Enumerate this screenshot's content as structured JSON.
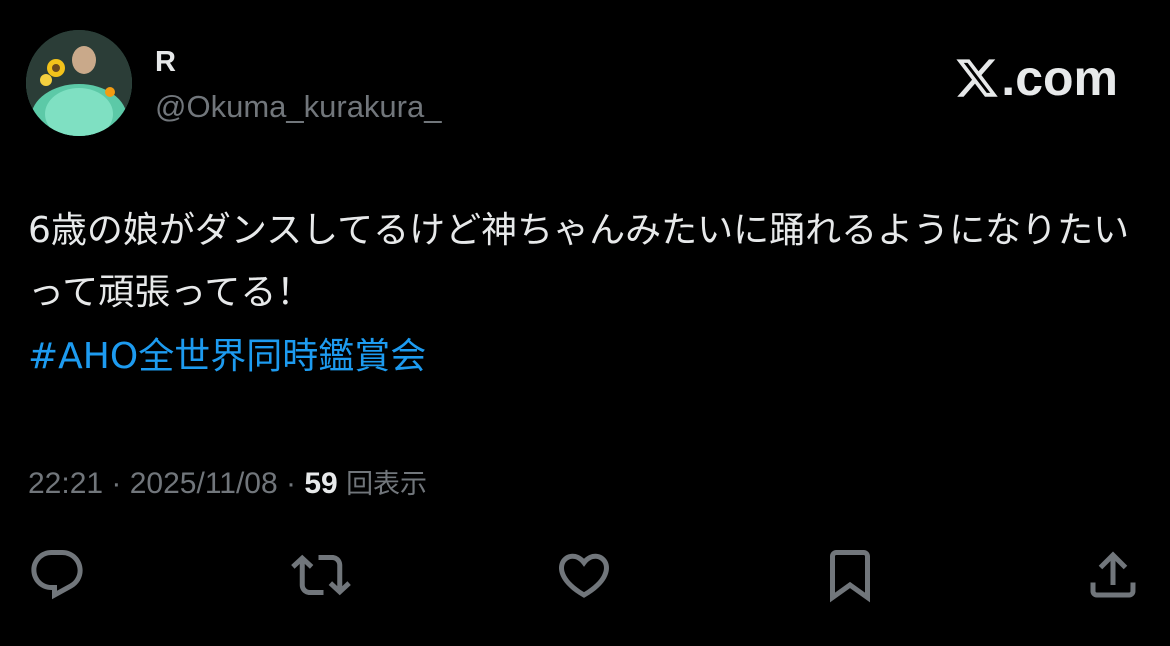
{
  "author": {
    "display_name": "R",
    "handle": "@Okuma_kurakura_"
  },
  "brand": {
    "label": ".com",
    "logo_icon": "x-logo-icon"
  },
  "tweet": {
    "text": "6歳の娘がダンスしてるけど神ちゃんみたいに踊れるようになりたいって頑張ってる！",
    "hashtag": "#AHO全世界同時鑑賞会"
  },
  "meta": {
    "time": "22:21",
    "separator": " · ",
    "date": "2025/11/08",
    "views_count": "59",
    "views_label": "回表示"
  },
  "actions": {
    "icons": [
      "reply-icon",
      "retweet-icon",
      "like-icon",
      "bookmark-icon",
      "share-icon"
    ]
  },
  "colors": {
    "background": "#000000",
    "text_primary": "#e7e9ea",
    "text_secondary": "#71767b",
    "accent": "#1d9bf0"
  }
}
